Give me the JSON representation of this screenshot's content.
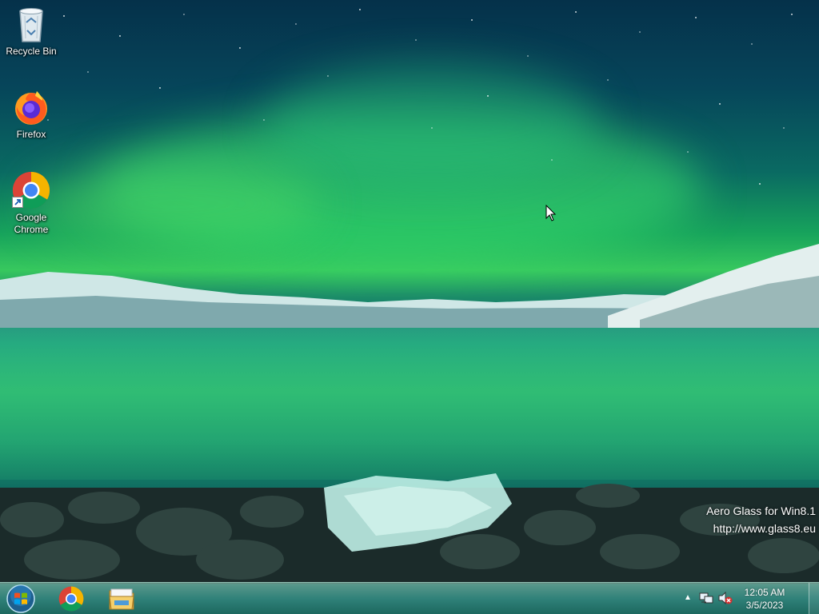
{
  "desktop": {
    "icons": [
      {
        "label": "Recycle Bin",
        "icon": "recycle-bin-icon"
      },
      {
        "label": "Firefox",
        "icon": "firefox-icon"
      },
      {
        "label": "Google Chrome",
        "icon": "chrome-icon",
        "shortcut": true
      }
    ],
    "watermark": {
      "line1": "Aero Glass for Win8.1",
      "line2": "http://www.glass8.eu"
    }
  },
  "taskbar": {
    "start_icon": "windows-start-icon",
    "pinned": [
      {
        "name": "Google Chrome",
        "icon": "chrome-icon"
      },
      {
        "name": "File Explorer",
        "icon": "folder-icon"
      }
    ],
    "tray": {
      "overflow_icon": "chevron-up-icon",
      "network_icon": "network-icon",
      "volume_icon": "volume-muted-icon",
      "time": "12:05 AM",
      "date": "3/5/2023"
    }
  },
  "colors": {
    "aurora": "#37c85e",
    "sky": "#05314a",
    "taskbar": "#3c968c"
  }
}
